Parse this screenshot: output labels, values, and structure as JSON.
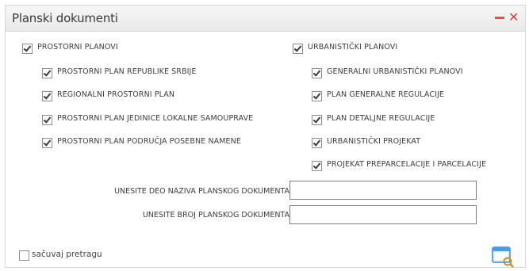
{
  "window": {
    "title": "Planski dokumenti"
  },
  "left_group": {
    "label": "PROSTORNI PLANOVI",
    "items": [
      {
        "label": "PROSTORNI PLAN REPUBLIKE SRBIJE"
      },
      {
        "label": "REGIONALNI PROSTORNI PLAN"
      },
      {
        "label": "PROSTORNI PLAN JEDINICE LOKALNE SAMOUPRAVE"
      },
      {
        "label": "PROSTORNI PLAN PODRUČJA POSEBNE NAMENE"
      }
    ]
  },
  "right_group": {
    "label": "URBANISTIČKI PLANOVI",
    "items": [
      {
        "label": "GENERALNI URBANISTIČKI PLANOVI"
      },
      {
        "label": "PLAN GENERALNE REGULACIJE"
      },
      {
        "label": "PLAN DETALJNE REGULACIJE"
      },
      {
        "label": "URBANISTIČKI PROJEKAT"
      },
      {
        "label": "PROJEKAT PREPARCELACIJE I PARCELACIJE"
      }
    ]
  },
  "form": {
    "name_label": "UNESITE DEO NAZIVA PLANSKOG DOKUMENTA",
    "name_value": "",
    "number_label": "UNESITE BROJ PLANSKOG DOKUMENTA",
    "number_value": ""
  },
  "footer": {
    "save_label": "sačuvaj pretragu"
  },
  "colors": {
    "close": "#e23b3b",
    "title_bg": "#ececec",
    "check": "#3a3a3a"
  },
  "icons": [
    "minimize-icon",
    "close-icon",
    "search-window-icon"
  ]
}
